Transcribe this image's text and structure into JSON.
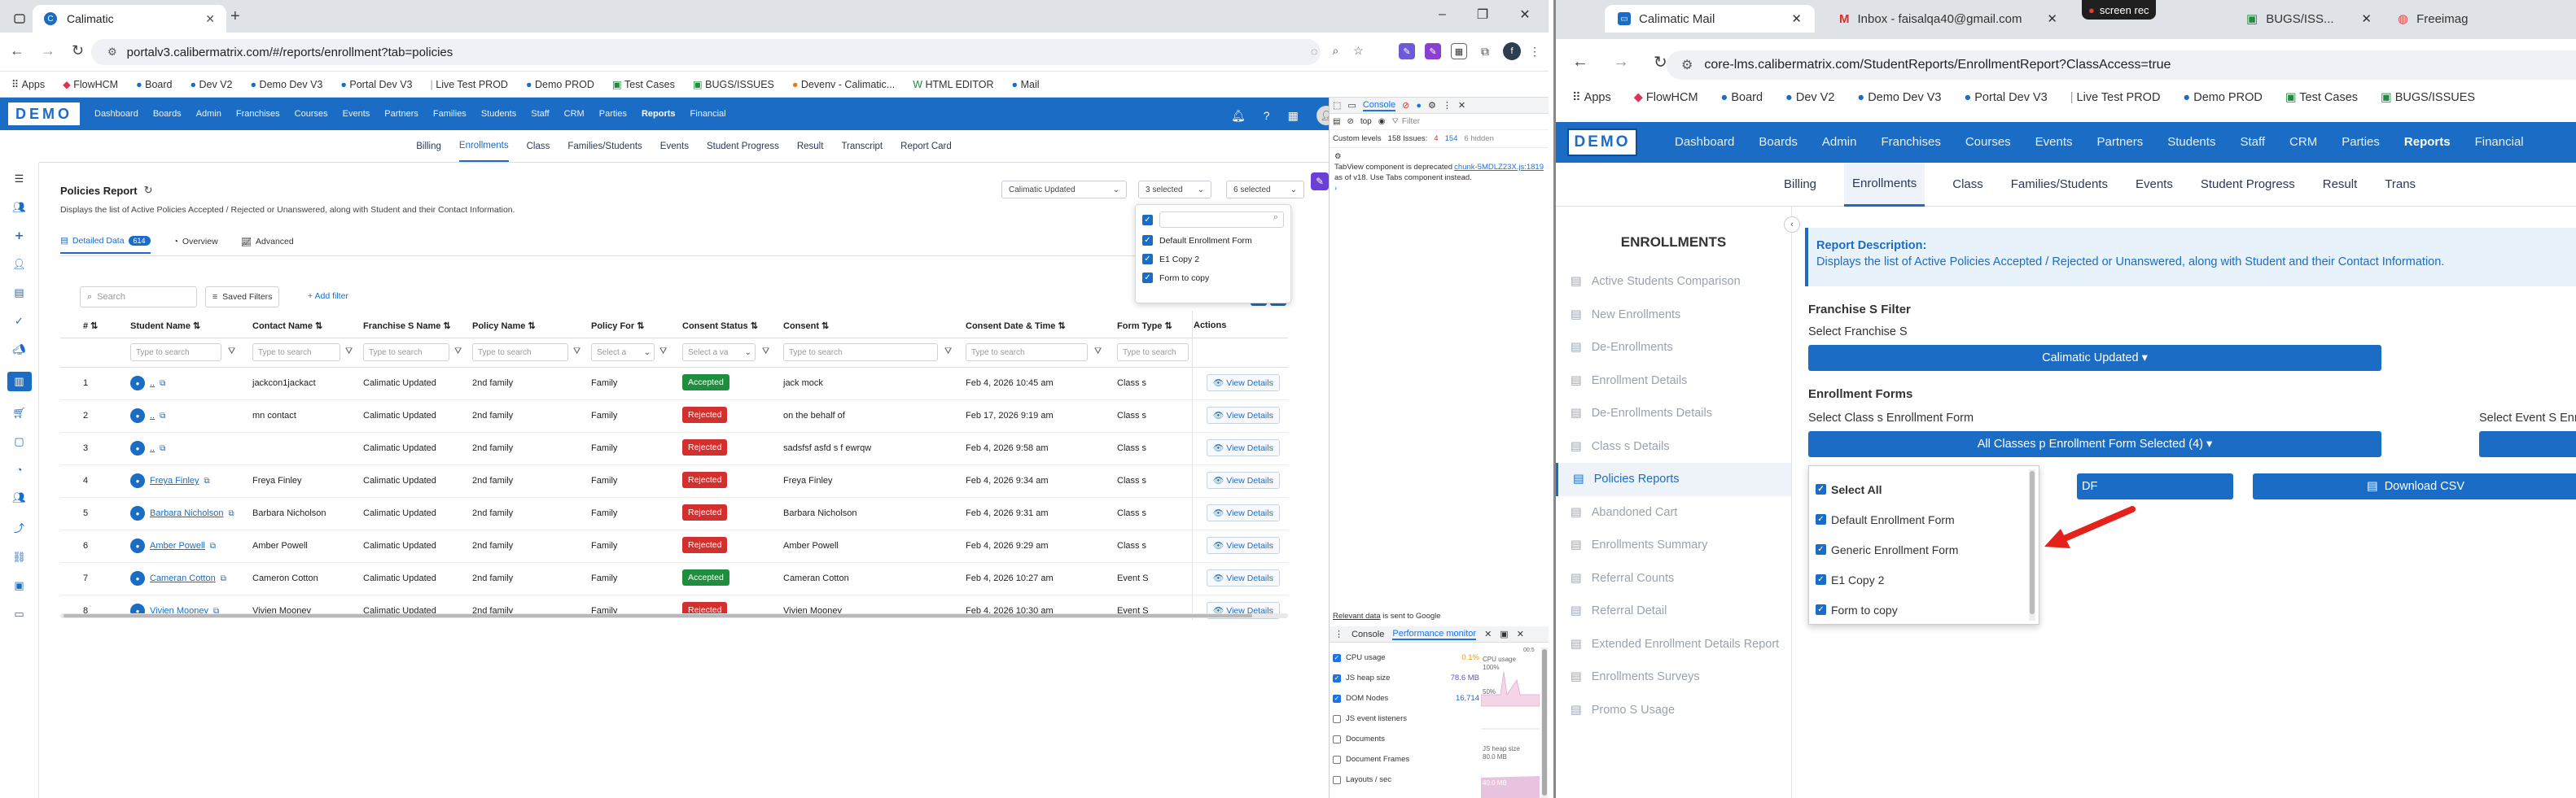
{
  "left": {
    "tab_title": "Calimatic",
    "url": "portalv3.calibermatrix.com/#/reports/enrollment?tab=policies",
    "bookmarks": [
      "Apps",
      "FlowHCM",
      "Board",
      "Dev V2",
      "Demo Dev V3",
      "Portal Dev V3",
      "Live Test PROD",
      "Demo PROD",
      "Test Cases",
      "BUGS/ISSUES",
      "Devenv - Calimatic...",
      "HTML EDITOR",
      "Mail"
    ],
    "logo": "DEMO",
    "main_nav": [
      "Dashboard",
      "Boards",
      "Admin",
      "Franchises",
      "Courses",
      "Events",
      "Partners",
      "Families",
      "Students",
      "Staff",
      "CRM",
      "Parties",
      "Reports",
      "Financial"
    ],
    "sub_nav": [
      "Billing",
      "Enrollments",
      "Class",
      "Families/Students",
      "Events",
      "Student Progress",
      "Result",
      "Transcript",
      "Report Card"
    ],
    "page_title": "Policies Report",
    "page_desc": "Displays the list of Active Policies Accepted / Rejected or Unanswered, along with Student and their Contact Information.",
    "franchise_select": "Calimatic Updated",
    "select2": "3 selected",
    "select3": "6 selected",
    "dropdown_items": [
      "Default Enrollment Form",
      "E1 Copy 2",
      "Form to copy"
    ],
    "view_tabs": {
      "detailed": "Detailed Data",
      "detailed_count": "614",
      "overview": "Overview",
      "advanced": "Advanced"
    },
    "search_placeholder": "Search",
    "saved_filters": "Saved Filters",
    "add_filter": "+ Add filter",
    "columns": [
      "#",
      "Student Name",
      "Contact Name",
      "Franchise S Name",
      "Policy Name",
      "Policy For",
      "Consent Status",
      "Consent",
      "Consent Date & Time",
      "Form Type",
      "Actions"
    ],
    "filter_placeholder": "Type to search",
    "select_placeholder": "Select a",
    "select_all_placeholder": "Select a va",
    "rows": [
      {
        "n": "1",
        "student": "..",
        "contact": "jackcon1jackact",
        "franchise": "Calimatic Updated",
        "policy": "2nd family",
        "for": "Family",
        "status": "Accepted",
        "consent": "jack mock",
        "date": "Feb 4, 2026 10:45 am",
        "form": "Class s"
      },
      {
        "n": "2",
        "student": "..",
        "contact": "mn contact",
        "franchise": "Calimatic Updated",
        "policy": "2nd family",
        "for": "Family",
        "status": "Rejected",
        "consent": "on the behalf of",
        "date": "Feb 17, 2026 9:19 am",
        "form": "Class s"
      },
      {
        "n": "3",
        "student": "..",
        "contact": "",
        "franchise": "Calimatic Updated",
        "policy": "2nd family",
        "for": "Family",
        "status": "Rejected",
        "consent": "sadsfsf asfd s f ewrqw",
        "date": "Feb 4, 2026 9:58 am",
        "form": "Class s"
      },
      {
        "n": "4",
        "student": "Freya Finley",
        "contact": "Freya Finley",
        "franchise": "Calimatic Updated",
        "policy": "2nd family",
        "for": "Family",
        "status": "Rejected",
        "consent": "Freya Finley",
        "date": "Feb 4, 2026 9:34 am",
        "form": "Class s"
      },
      {
        "n": "5",
        "student": "Barbara Nicholson",
        "contact": "Barbara Nicholson",
        "franchise": "Calimatic Updated",
        "policy": "2nd family",
        "for": "Family",
        "status": "Rejected",
        "consent": "Barbara Nicholson",
        "date": "Feb 4, 2026 9:31 am",
        "form": "Class s"
      },
      {
        "n": "6",
        "student": "Amber Powell",
        "contact": "Amber Powell",
        "franchise": "Calimatic Updated",
        "policy": "2nd family",
        "for": "Family",
        "status": "Rejected",
        "consent": "Amber Powell",
        "date": "Feb 4, 2026 9:29 am",
        "form": "Class s"
      },
      {
        "n": "7",
        "student": "Cameran Cotton",
        "contact": "Cameron Cotton",
        "franchise": "Calimatic Updated",
        "policy": "2nd family",
        "for": "Family",
        "status": "Accepted",
        "consent": "Cameran Cotton",
        "date": "Feb 4, 2026 10:27 am",
        "form": "Event S"
      },
      {
        "n": "8",
        "student": "Vivien Mooney",
        "contact": "Vivien Mooney",
        "franchise": "Calimatic Updated",
        "policy": "2nd family",
        "for": "Family",
        "status": "Rejected",
        "consent": "Vivien Mooney",
        "date": "Feb 4, 2026 10:30 am",
        "form": "Event S"
      }
    ],
    "view_details": "View Details",
    "devtools": {
      "tab_console": "Console",
      "top": "top",
      "filter": "Filter",
      "custom_levels": "Custom levels",
      "issues": "158 Issues:",
      "issues_err": "4",
      "issues_warn": "154",
      "hidden": "6 hidden",
      "source_link": "chunk-5MDLZ23X.js:1819",
      "msg": "TabView component is deprecated as of v18. Use Tabs component instead.",
      "relevant": "Relevant data",
      "relevant_rest": " is sent to Google",
      "drawer_console": "Console",
      "drawer_perf": "Performance monitor",
      "metrics": [
        {
          "label": "CPU usage",
          "value": "0.1%",
          "checked": true
        },
        {
          "label": "JS heap size",
          "value": "78.6 MB",
          "checked": true
        },
        {
          "label": "DOM Nodes",
          "value": "16,714",
          "checked": true
        },
        {
          "label": "JS event listeners",
          "value": "",
          "checked": false
        },
        {
          "label": "Documents",
          "value": "",
          "checked": false
        },
        {
          "label": "Document Frames",
          "value": "",
          "checked": false
        },
        {
          "label": "Layouts / sec",
          "value": "",
          "checked": false
        }
      ],
      "chart_cpu_label": "CPU usage",
      "chart_cpu_100": "100%",
      "chart_cpu_50": "50%",
      "chart_heap_label": "JS heap size",
      "chart_heap_val": "80.0 MB",
      "chart_heap_val2": "40.0 MB",
      "time_label": "00:5"
    }
  },
  "right": {
    "tabs": [
      "Calimatic Mail",
      "Inbox - faisalqa40@gmail.com",
      "BUGS/ISS...",
      "Freeimag"
    ],
    "screenrec": "screen rec",
    "url": "core-lms.calibermatrix.com/StudentReports/EnrollmentReport?ClassAccess=true",
    "bookmarks": [
      "Apps",
      "FlowHCM",
      "Board",
      "Dev V2",
      "Demo Dev V3",
      "Portal Dev V3",
      "Live Test PROD",
      "Demo PROD",
      "Test Cases",
      "BUGS/ISSUES"
    ],
    "logo": "DEMO",
    "main_nav": [
      "Dashboard",
      "Boards",
      "Admin",
      "Franchises",
      "Courses",
      "Events",
      "Partners",
      "Students",
      "Staff",
      "CRM",
      "Parties",
      "Reports",
      "Financial"
    ],
    "sub_nav": [
      "Billing",
      "Enrollments",
      "Class",
      "Families/Students",
      "Events",
      "Student Progress",
      "Result",
      "Trans"
    ],
    "sidebar_title": "ENROLLMENTS",
    "sidebar": [
      "Active Students Comparison",
      "New Enrollments",
      "De-Enrollments",
      "Enrollment Details",
      "De-Enrollments Details",
      "Class s Details",
      "Policies Reports",
      "Abandoned Cart",
      "Enrollments Summary",
      "Referral Counts",
      "Referral Detail",
      "Extended Enrollment Details Report",
      "Enrollments Surveys",
      "Promo S Usage"
    ],
    "active_index": 6,
    "desc_title": "Report Description:",
    "desc_text": "Displays the list of Active Policies Accepted / Rejected or Unanswered, along with Student and their Contact Information.",
    "franchise_filter": "Franchise S Filter",
    "select_franchise": "Select Franchise S",
    "franchise_value": "Calimatic Updated",
    "enroll_forms": "Enrollment Forms",
    "select_class_form": "Select Class s Enrollment Form",
    "select_event_form": "Select Event S Enr",
    "forms_value": "All Classes p Enrollment Form Selected (4)",
    "download_pdf": "DF",
    "download_csv": "Download CSV",
    "checklist": [
      "Select All",
      "Default Enrollment Form",
      "Generic Enrollment Form",
      "E1 Copy 2",
      "Form to copy"
    ]
  },
  "colors": {
    "brand": "#1b6cc5",
    "accepted": "#1e8e3e",
    "rejected": "#d32f2f",
    "arrow": "#e5211b"
  }
}
